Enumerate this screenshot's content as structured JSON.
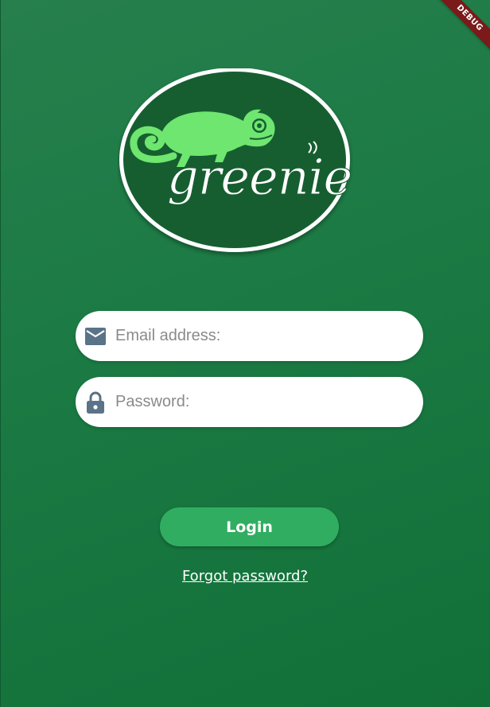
{
  "debug_banner": "DEBUG",
  "logo": {
    "text": "greenie",
    "icon": "chameleon-icon"
  },
  "email": {
    "placeholder": "Email address:",
    "value": "",
    "icon": "mail-icon"
  },
  "password": {
    "placeholder": "Password:",
    "value": "",
    "icon": "lock-icon"
  },
  "login_button": {
    "label": "Login"
  },
  "forgot_password": {
    "label": "Forgot password?"
  },
  "colors": {
    "background": "#1b7a43",
    "button": "#31ad62",
    "logo_fill": "#165e30",
    "chameleon": "#6ee66f",
    "icon": "#5b7388"
  }
}
